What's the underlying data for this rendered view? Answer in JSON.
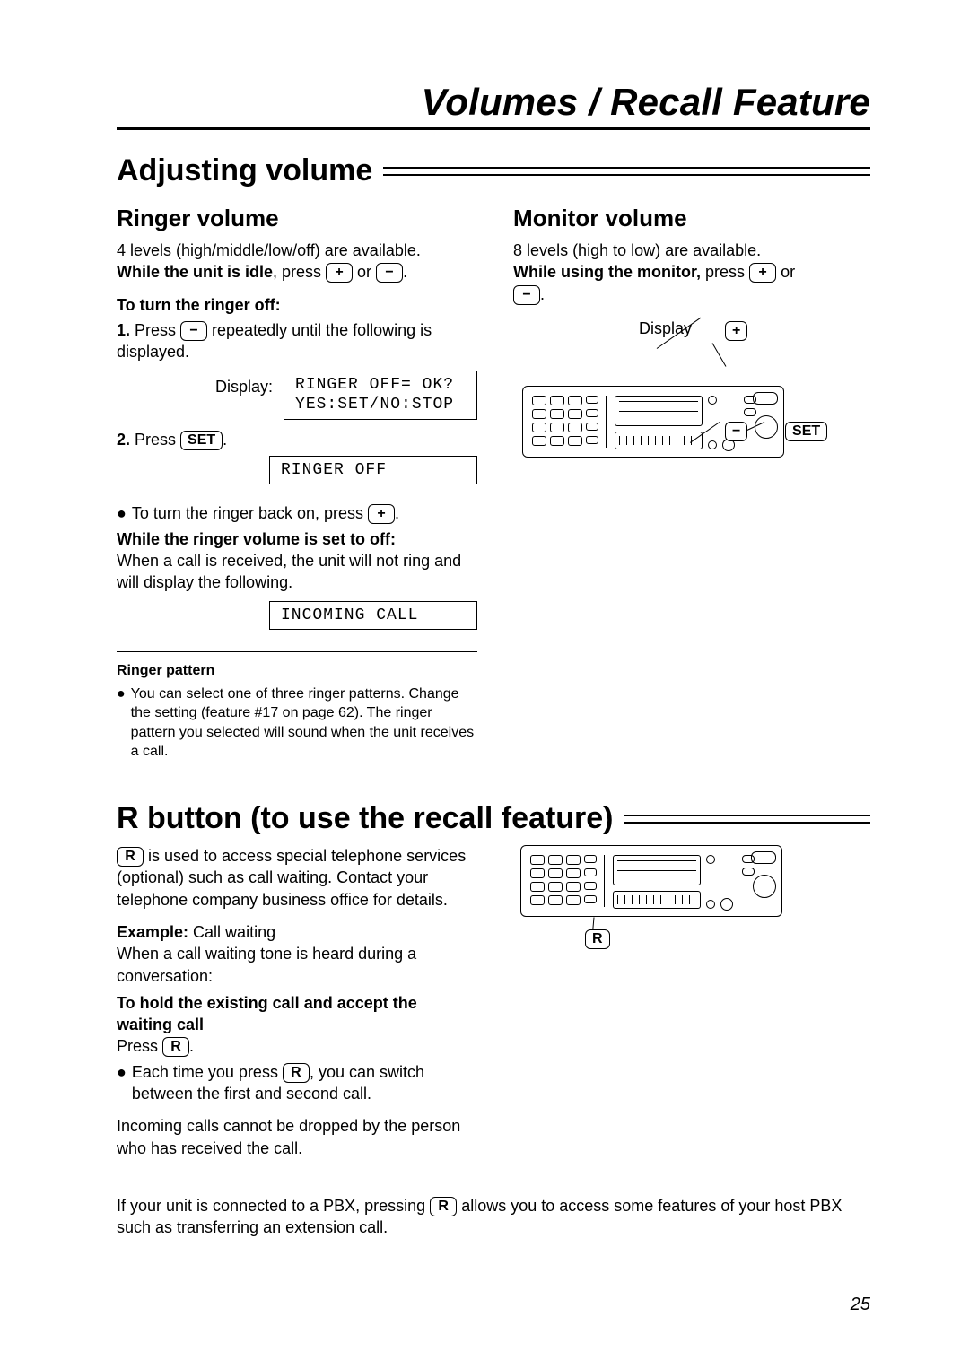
{
  "page_title": "Volumes / Recall Feature",
  "page_number": "25",
  "keys": {
    "plus": "+",
    "minus": "−",
    "set": "SET",
    "r": "R"
  },
  "adjusting": {
    "heading": "Adjusting volume",
    "ringer": {
      "heading": "Ringer volume",
      "levels": "4 levels (high/middle/low/off) are available.",
      "idle_prefix": "While the unit is idle",
      "idle_mid": ", press ",
      "idle_or": " or ",
      "idle_end": ".",
      "off_heading": "To turn the ringer off:",
      "step1_a": "1.",
      "step1_b": " Press ",
      "step1_c": " repeatedly until the following is displayed.",
      "display_label": "Display:",
      "lcd1_line1": "RINGER OFF= OK?",
      "lcd1_line2": "YES:SET/NO:STOP",
      "step2_a": "2.",
      "step2_b": " Press ",
      "step2_c": ".",
      "lcd2": "RINGER OFF",
      "back_on_a": "To turn the ringer back on, press ",
      "back_on_b": ".",
      "set_off_heading": "While the ringer volume is set to off:",
      "set_off_body": "When a call is received, the unit will not ring and will display the following.",
      "lcd3": "INCOMING CALL",
      "pattern_heading": "Ringer pattern",
      "pattern_body": "You can select one of three ringer patterns. Change the setting (feature #17 on page 62). The ringer pattern you selected will sound when the unit receives a call."
    },
    "monitor": {
      "heading": "Monitor volume",
      "levels": "8 levels (high to low) are available.",
      "using_prefix": "While using the monitor,",
      "using_mid": " press ",
      "using_or": " or ",
      "using_end": ".",
      "display_label": "Display",
      "callout_plus": "+",
      "callout_minus": "−",
      "callout_set": "SET"
    }
  },
  "recall": {
    "heading": "R button (to use the recall feature)",
    "intro_a": " is used to access special telephone services (optional) such as call waiting. Contact your telephone company business office for details.",
    "example_label": "Example:",
    "example_name": " Call waiting",
    "example_body": "When a call waiting tone is heard during a conversation:",
    "hold_heading": "To hold the existing call and accept the waiting call",
    "press_prefix": "Press ",
    "press_suffix": ".",
    "switch_a": "Each time you press ",
    "switch_b": ", you can switch between the first and second call.",
    "nodrop": "Incoming calls cannot be dropped by the person who has received the call.",
    "pbx_a": "If your unit is connected to a PBX, pressing ",
    "pbx_b": " allows you to access some features of your host PBX such as transferring an extension call.",
    "callout_r": "R"
  }
}
